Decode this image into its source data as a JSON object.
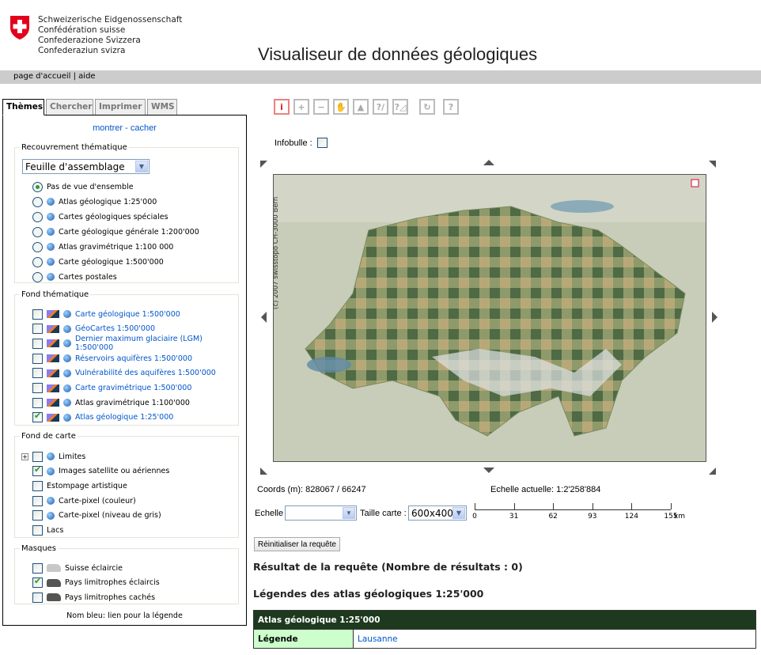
{
  "header": {
    "federation_lines": [
      "Schweizerische Eidgenossenschaft",
      "Confédération suisse",
      "Confederazione Svizzera",
      "Confederaziun svizra"
    ],
    "title": "Visualiseur de données géologiques"
  },
  "nav": {
    "home": "page d'accueil",
    "separator": "|",
    "help": "aide"
  },
  "tabs": [
    {
      "label": "Thèmes",
      "active": true
    },
    {
      "label": "Chercher"
    },
    {
      "label": "Imprimer"
    },
    {
      "label": "WMS"
    }
  ],
  "panel": {
    "show": "montrer",
    "dash": "-",
    "hide": "cacher",
    "overlay": {
      "legend": "Recouvrement thématique",
      "select_value": "Feuille d'assemblage",
      "options": [
        {
          "label": "Pas de vue d'ensemble",
          "selected": true
        },
        {
          "label": "Atlas géologique 1:25'000"
        },
        {
          "label": "Cartes géologiques spéciales"
        },
        {
          "label": "Carte géologique générale 1:200'000"
        },
        {
          "label": "Atlas gravimétrique 1:100 000"
        },
        {
          "label": "Carte géologique 1:500'000"
        },
        {
          "label": "Cartes postales"
        }
      ]
    },
    "thematic": {
      "legend": "Fond thématique",
      "items": [
        {
          "label": "Carte géologique 1:500'000",
          "checked": false,
          "link": true
        },
        {
          "label": "GéoCartes 1:500'000",
          "checked": false,
          "link": true
        },
        {
          "label": "Dernier maximum glaciaire (LGM) 1:500'000",
          "checked": false,
          "link": true
        },
        {
          "label": "Réservoirs aquifères 1:500'000",
          "checked": false,
          "link": true
        },
        {
          "label": "Vulnérabilité des aquifères 1:500'000",
          "checked": false,
          "link": true
        },
        {
          "label": "Carte gravimétrique 1:500'000",
          "checked": false,
          "link": true
        },
        {
          "label": "Atlas gravimétrique 1:100'000",
          "checked": false,
          "link": false
        },
        {
          "label": "Atlas géologique 1:25'000",
          "checked": true,
          "link": true
        }
      ]
    },
    "basemap": {
      "legend": "Fond de carte",
      "items": [
        {
          "label": "Limites",
          "checked": false,
          "globe": true,
          "expand": true
        },
        {
          "label": "Images satellite ou aériennes",
          "checked": true,
          "globe": true
        },
        {
          "label": "Estompage artistique",
          "checked": false,
          "globe": false
        },
        {
          "label": "Carte-pixel (couleur)",
          "checked": false,
          "globe": true
        },
        {
          "label": "Carte-pixel (niveau de gris)",
          "checked": false,
          "globe": true
        },
        {
          "label": "Lacs",
          "checked": false,
          "globe": false
        }
      ]
    },
    "masks": {
      "legend": "Masques",
      "items": [
        {
          "label": "Suisse éclaircie",
          "checked": false
        },
        {
          "label": "Pays limitrophes éclaircis",
          "checked": true
        },
        {
          "label": "Pays limitrophes cachés",
          "checked": false
        }
      ]
    },
    "footnote": "Nom bleu: lien pour la légende"
  },
  "toolbar": [
    {
      "icon": "info-icon",
      "active": true
    },
    {
      "icon": "zoom-in-icon"
    },
    {
      "icon": "zoom-out-icon"
    },
    {
      "icon": "pan-hand-icon"
    },
    {
      "icon": "full-extent-icon"
    },
    {
      "icon": "measure-distance-icon"
    },
    {
      "icon": "measure-area-icon"
    },
    {
      "icon": "refresh-icon"
    },
    {
      "icon": "help-icon"
    }
  ],
  "infobulle": {
    "label": "Infobulle :",
    "checked": false
  },
  "map": {
    "copyright": "(c) 2007 swisstopo CH-3000 Bern"
  },
  "status": {
    "coords": "Coords (m): 828067 / 66247",
    "scale": "Echelle actuelle: 1:2'258'884"
  },
  "controls": {
    "scale_label": "Echelle",
    "scale_value": "",
    "size_label": "Taille carte :",
    "size_value": "600x400",
    "scalebar": [
      "0",
      "31",
      "62",
      "93",
      "124",
      "155"
    ],
    "scalebar_unit": "km",
    "reset": "Réinitialiser la requête"
  },
  "results": {
    "title": "Résultat de la requête (Nombre de résultats : 0)",
    "legends_title": "Légendes des atlas géologiques 1:25'000",
    "table": {
      "header": "Atlas géologique 1:25'000",
      "key": "Légende",
      "value": "Lausanne"
    }
  },
  "colors": {
    "link": "#0055cc",
    "table_header": "#1e3a1e",
    "table_key": "#ccffcc",
    "nav_bar": "#cccccc"
  }
}
